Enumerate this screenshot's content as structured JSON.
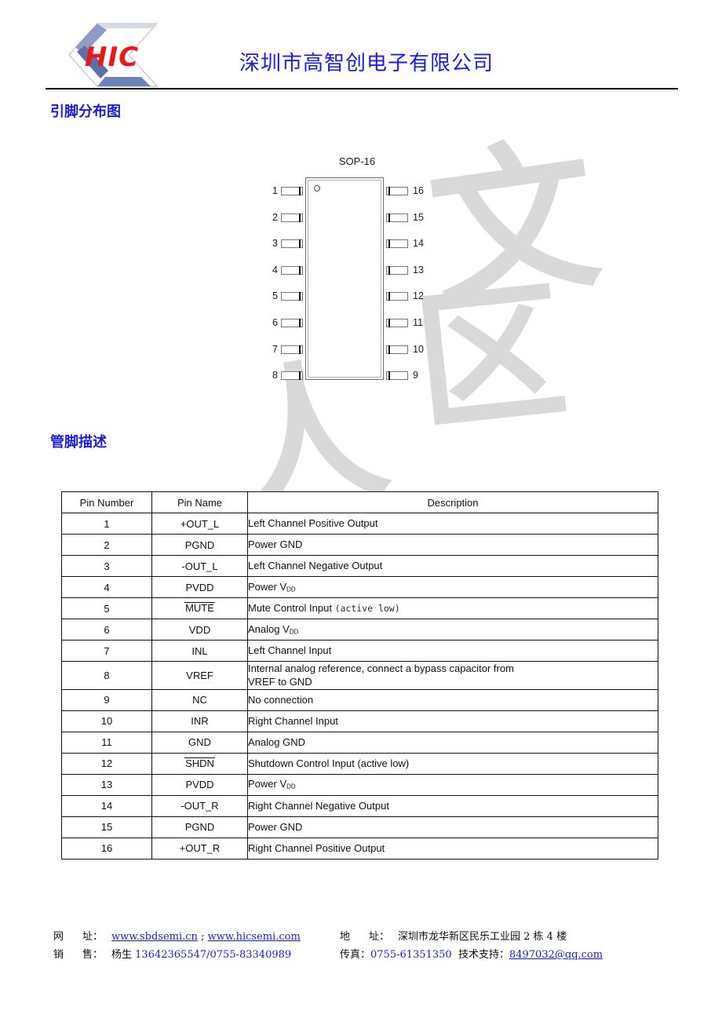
{
  "header": {
    "logo_text": "HIC",
    "company_name": "深圳市高智创电子有限公司",
    "brand_red": "#e8191b",
    "brand_blue": "#1a1ae6"
  },
  "sections": {
    "pinout_heading": "引脚分布图",
    "pindesc_heading": "管脚描述"
  },
  "pin_diagram": {
    "package_label": "SOP-16",
    "left_pins": [
      "1",
      "2",
      "3",
      "4",
      "5",
      "6",
      "7",
      "8"
    ],
    "right_pins": [
      "16",
      "15",
      "14",
      "13",
      "12",
      "11",
      "10",
      "9"
    ]
  },
  "pin_table": {
    "columns": [
      "Pin Number",
      "Pin Name",
      "Description"
    ],
    "rows": [
      {
        "num": "1",
        "name": "+OUT_L",
        "name_overline": false,
        "desc": "Left Channel Positive Output"
      },
      {
        "num": "2",
        "name": "PGND",
        "name_overline": false,
        "desc": "Power GND"
      },
      {
        "num": "3",
        "name": "-OUT_L",
        "name_overline": false,
        "desc": "Left Channel Negative Output"
      },
      {
        "num": "4",
        "name": "PVDD",
        "name_overline": false,
        "desc": "Power VDD",
        "desc_html": "Power V<span class=\"vdd-sub\">dd</span>"
      },
      {
        "num": "5",
        "name": "MUTE",
        "name_overline": true,
        "desc": "Mute Control Input (active low)",
        "desc_html": "Mute Control Input <span class=\"mono-note\">(active low)</span>"
      },
      {
        "num": "6",
        "name": "VDD",
        "name_overline": false,
        "desc": "Analog VDD",
        "desc_html": "Analog V<span class=\"vdd-sub\">dd</span>"
      },
      {
        "num": "7",
        "name": "INL",
        "name_overline": false,
        "desc": "Left Channel Input"
      },
      {
        "num": "8",
        "name": "VREF",
        "name_overline": false,
        "desc": "Internal analog reference, connect a bypass capacitor from VREF to GND",
        "desc_html": "Internal analog reference, connect a bypass capacitor from<br>VREF to GND"
      },
      {
        "num": "9",
        "name": "NC",
        "name_overline": false,
        "desc": "No connection"
      },
      {
        "num": "10",
        "name": "INR",
        "name_overline": false,
        "desc": "Right Channel Input"
      },
      {
        "num": "11",
        "name": "GND",
        "name_overline": false,
        "desc": "Analog GND"
      },
      {
        "num": "12",
        "name": "SHDN",
        "name_overline": true,
        "desc": "Shutdown Control Input (active low)"
      },
      {
        "num": "13",
        "name": "PVDD",
        "name_overline": false,
        "desc": "Power VDD",
        "desc_html": "Power V<span class=\"vdd-sub\">dd</span>"
      },
      {
        "num": "14",
        "name": "-OUT_R",
        "name_overline": false,
        "desc": "Right Channel Negative Output"
      },
      {
        "num": "15",
        "name": "PGND",
        "name_overline": false,
        "desc": "Power GND"
      },
      {
        "num": "16",
        "name": "+OUT_R",
        "name_overline": false,
        "desc": "Right Channel Positive Output"
      }
    ]
  },
  "footer": {
    "row1": {
      "left_label": "网",
      "left_label2": "址：",
      "website_1": "www.sbdsemi.cn",
      "website_sep": " ; ",
      "website_2": "www.hicsemi.com",
      "right_label": "地",
      "right_label2": "址：",
      "address": "深圳市龙华新区民乐工业园 2 栋 4 楼"
    },
    "row2": {
      "left_label": "销",
      "left_label2": "售：",
      "sales_contact": "杨生",
      "sales_phone": "13642365547/0755-83340989",
      "fax_label": "传真：",
      "fax": "0755-61351350",
      "support_label": "技术支持：",
      "support_email": "8497032@qq.com"
    }
  },
  "watermark": {
    "chars": [
      "文",
      "区",
      "人"
    ]
  }
}
